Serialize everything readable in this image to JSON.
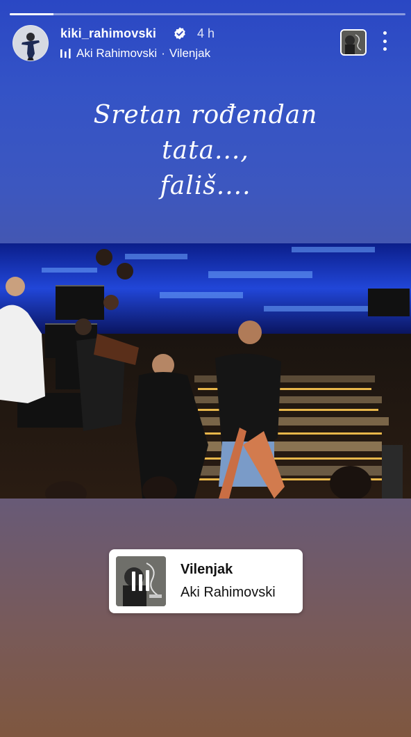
{
  "story": {
    "progress_fraction": 0.11,
    "username": "kiki_rahimovski",
    "time_ago": "4 h",
    "music_artist": "Aki Rahimovski",
    "music_separator": "·",
    "music_song": "Vilenjak",
    "caption_lines": [
      "Sretan rođendan",
      "tata...,",
      "fališ...."
    ],
    "sticker": {
      "title": "Vilenjak",
      "artist": "Aki Rahimovski"
    }
  },
  "icons": {
    "verified": "verified-badge-icon",
    "music": "music-bars-icon",
    "more": "more-vertical-icon"
  },
  "colors": {
    "verified": "#3897f0",
    "text": "#ffffff"
  }
}
